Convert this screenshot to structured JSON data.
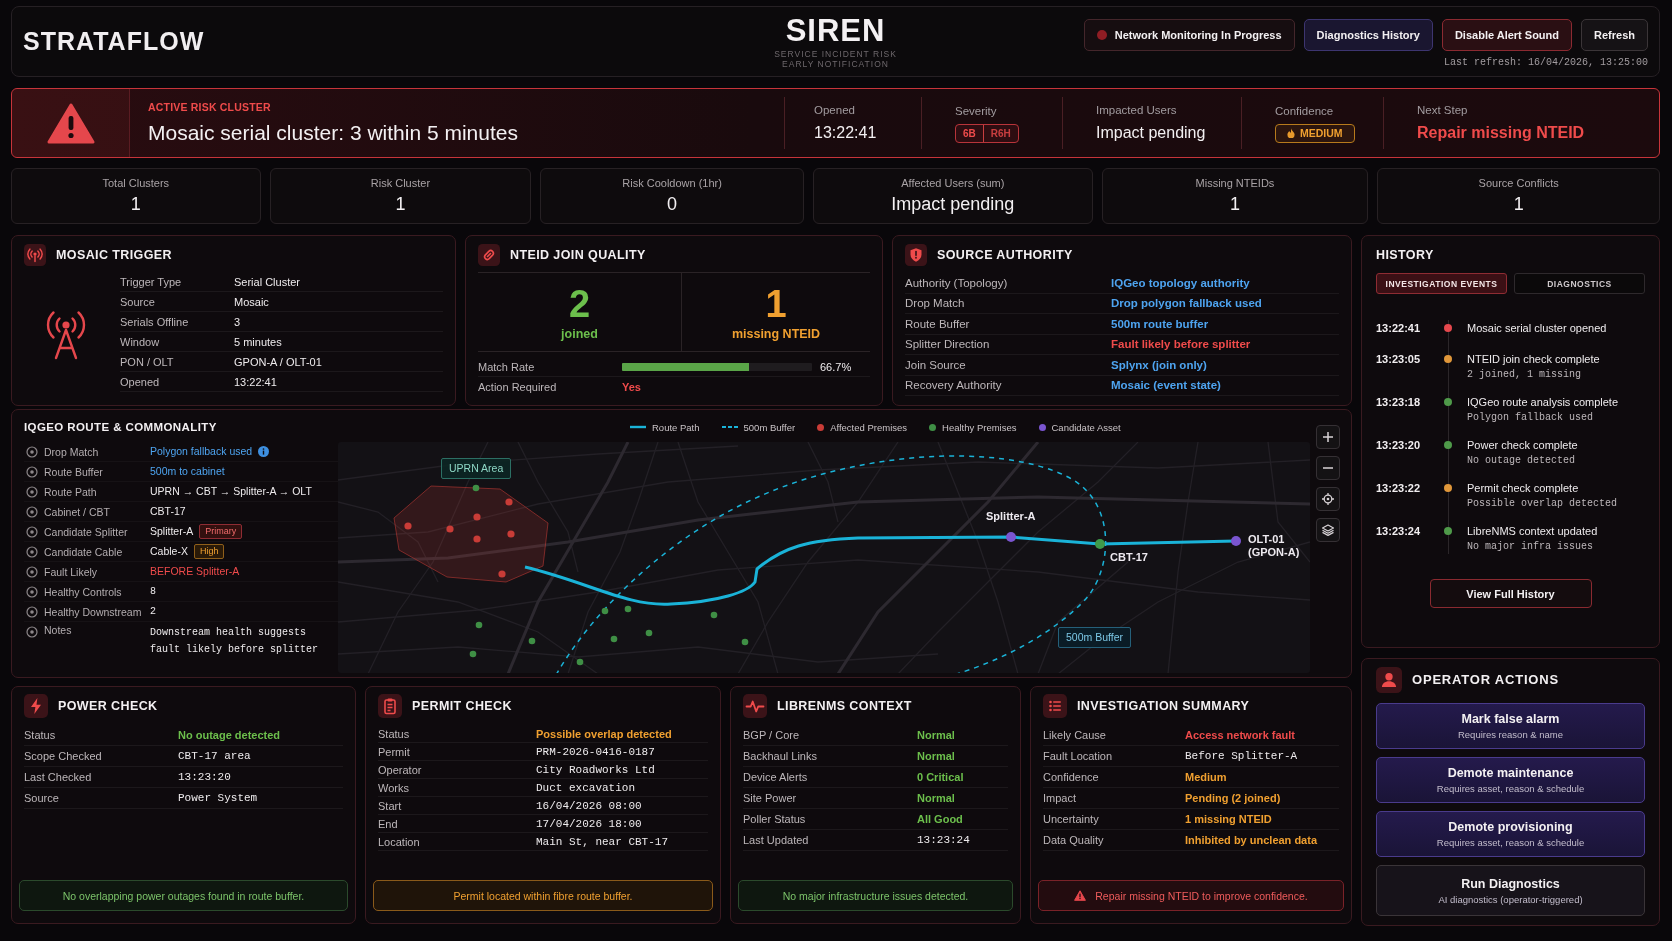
{
  "header": {
    "brand": "STRATAFLOW",
    "title": "SIREN",
    "subtitle": "SERVICE INCIDENT RISK EARLY NOTIFICATION",
    "buttons": [
      {
        "label": "Network Monitoring In Progress",
        "kind": "status"
      },
      {
        "label": "Diagnostics History",
        "kind": "accent"
      },
      {
        "label": "Disable Alert Sound",
        "kind": "danger"
      },
      {
        "label": "Refresh",
        "kind": "neutral"
      }
    ],
    "last_refresh": "Last refresh: 16/04/2026, 13:25:00"
  },
  "alert": {
    "eyebrow": "ACTIVE RISK CLUSTER",
    "title": "Mosaic serial cluster: 3 within 5 minutes",
    "fields": [
      {
        "label": "Opened",
        "kind": "text",
        "value": "13:22:41"
      },
      {
        "label": "Severity",
        "kind": "split",
        "parts": [
          "6B",
          "R6H"
        ]
      },
      {
        "label": "Impacted Users",
        "kind": "text",
        "value": "Impact pending"
      },
      {
        "label": "Confidence",
        "kind": "badge",
        "value": "MEDIUM"
      },
      {
        "label": "Next Step",
        "kind": "alert",
        "value": "Repair missing NTEID"
      }
    ]
  },
  "stats": [
    {
      "label": "Total Clusters",
      "value": "1"
    },
    {
      "label": "Risk Cluster",
      "value": "1"
    },
    {
      "label": "Risk Cooldown (1hr)",
      "value": "0"
    },
    {
      "label": "Affected Users (sum)",
      "value": "Impact pending"
    },
    {
      "label": "Missing NTEIDs",
      "value": "1"
    },
    {
      "label": "Source Conflicts",
      "value": "1"
    }
  ],
  "mosaic_trigger": {
    "title": "MOSAIC TRIGGER",
    "rows": [
      {
        "label": "Trigger Type",
        "value": "Serial Cluster",
        "kind": "plain"
      },
      {
        "label": "Source",
        "value": "Mosaic",
        "kind": "plain"
      },
      {
        "label": "Serials Offline",
        "value": "3",
        "kind": "plain"
      },
      {
        "label": "Window",
        "value": "5 minutes",
        "kind": "plain"
      },
      {
        "label": "PON / OLT",
        "value": "GPON-A / OLT-01",
        "kind": "plain"
      },
      {
        "label": "Opened",
        "value": "13:22:41",
        "kind": "plain"
      }
    ]
  },
  "nteid_join_quality": {
    "title": "NTEID JOIN QUALITY",
    "counts": [
      {
        "value": "2",
        "label": "joined",
        "kind": "success"
      },
      {
        "value": "1",
        "label": "missing NTEID",
        "kind": "warning"
      }
    ],
    "match_rate": {
      "label": "Match Rate",
      "level": 0.667,
      "reading": "66.7%"
    },
    "action_required": {
      "label": "Action Required",
      "value": "Yes",
      "kind": "danger"
    }
  },
  "source_authority": {
    "title": "SOURCE AUTHORITY",
    "rows": [
      {
        "label": "Authority (Topology)",
        "value": "IQGeo topology authority",
        "kind": "info"
      },
      {
        "label": "Drop Match",
        "value": "Drop polygon fallback used",
        "kind": "info"
      },
      {
        "label": "Route Buffer",
        "value": "500m route buffer",
        "kind": "info"
      },
      {
        "label": "Splitter Direction",
        "value": "Fault likely before splitter",
        "kind": "danger"
      },
      {
        "label": "Join Source",
        "value": "Splynx (join only)",
        "kind": "info"
      },
      {
        "label": "Recovery Authority",
        "value": "Mosaic (event state)",
        "kind": "info"
      }
    ]
  },
  "route": {
    "title": "IQGEO ROUTE & COMMONALITY",
    "rows": [
      {
        "label": "Drop Match",
        "value": "Polygon fallback used",
        "kind": "info",
        "info": true
      },
      {
        "label": "Route Buffer",
        "value": "500m to cabinet",
        "kind": "info",
        "info": false
      },
      {
        "label": "Route Path",
        "value": "UPRN → CBT → Splitter-A → OLT",
        "kind": "plain",
        "info": false
      },
      {
        "label": "Cabinet / CBT",
        "value": "CBT-17",
        "kind": "plain",
        "info": false
      },
      {
        "label": "Candidate Splitter",
        "value": "Splitter-A",
        "kind": "plain",
        "info": false,
        "badge": {
          "label": "Primary",
          "kind": "danger"
        }
      },
      {
        "label": "Candidate Cable",
        "value": "Cable-X",
        "kind": "plain",
        "info": false,
        "badge": {
          "label": "High",
          "kind": "warning"
        }
      },
      {
        "label": "Fault Likely",
        "value": "BEFORE Splitter-A",
        "kind": "danger",
        "info": false
      },
      {
        "label": "Healthy Controls",
        "value": "8",
        "kind": "mono",
        "info": false
      },
      {
        "label": "Healthy Downstream",
        "value": "2",
        "kind": "mono",
        "info": false
      },
      {
        "label": "Notes",
        "value": "Downstream health suggests fault likely before splitter",
        "kind": "mono",
        "info": false
      }
    ],
    "legend": [
      {
        "label": "Route Path",
        "kind": "line",
        "color": "#1ab3d8"
      },
      {
        "label": "500m Buffer",
        "kind": "dashed",
        "color": "#1ab3d8"
      },
      {
        "label": "Affected Premises",
        "kind": "dot",
        "color": "#c93c37"
      },
      {
        "label": "Healthy Premises",
        "kind": "dot",
        "color": "#3f8f45"
      },
      {
        "label": "Candidate Asset",
        "kind": "dot",
        "color": "#7a55d0"
      }
    ],
    "area_label": "UPRN Area",
    "buffer_label": "500m Buffer",
    "nodes": [
      {
        "label": "Splitter-A",
        "color": "#7a55d0"
      },
      {
        "label": "CBT-17",
        "color": "#3f9a4a"
      },
      {
        "label": "OLT-01 (GPON-A)",
        "color": "#7a55d0"
      }
    ]
  },
  "power_check": {
    "title": "POWER CHECK",
    "rows": [
      {
        "label": "Status",
        "value": "No outage detected",
        "kind": "success"
      },
      {
        "label": "Scope Checked",
        "value": "CBT-17 area",
        "kind": "mono"
      },
      {
        "label": "Last Checked",
        "value": "13:23:20",
        "kind": "mono"
      },
      {
        "label": "Source",
        "value": "Power System",
        "kind": "mono"
      }
    ],
    "note": {
      "text": "No overlapping power outages found in route buffer.",
      "kind": "success"
    }
  },
  "permit_check": {
    "title": "PERMIT CHECK",
    "rows": [
      {
        "label": "Status",
        "value": "Possible overlap detected",
        "kind": "warning"
      },
      {
        "label": "Permit",
        "value": "PRM-2026-0416-0187",
        "kind": "mono"
      },
      {
        "label": "Operator",
        "value": "City Roadworks Ltd",
        "kind": "mono"
      },
      {
        "label": "Works",
        "value": "Duct excavation",
        "kind": "mono"
      },
      {
        "label": "Start",
        "value": "16/04/2026 08:00",
        "kind": "mono"
      },
      {
        "label": "End",
        "value": "17/04/2026 18:00",
        "kind": "mono"
      },
      {
        "label": "Location",
        "value": "Main St, near CBT-17",
        "kind": "mono"
      }
    ],
    "note": {
      "text": "Permit located within fibre route buffer.",
      "kind": "warning"
    }
  },
  "librenms_context": {
    "title": "LIBRENMS CONTEXT",
    "rows": [
      {
        "label": "BGP / Core",
        "value": "Normal",
        "kind": "success"
      },
      {
        "label": "Backhaul Links",
        "value": "Normal",
        "kind": "success"
      },
      {
        "label": "Device Alerts",
        "value": "0 Critical",
        "kind": "success"
      },
      {
        "label": "Site Power",
        "value": "Normal",
        "kind": "success"
      },
      {
        "label": "Poller Status",
        "value": "All Good",
        "kind": "success"
      },
      {
        "label": "Last Updated",
        "value": "13:23:24",
        "kind": "mono"
      }
    ],
    "note": {
      "text": "No major infrastructure issues detected.",
      "kind": "success"
    }
  },
  "investigation_summary": {
    "title": "INVESTIGATION SUMMARY",
    "rows": [
      {
        "label": "Likely Cause",
        "value": "Access network fault",
        "kind": "danger"
      },
      {
        "label": "Fault Location",
        "value": "Before Splitter-A",
        "kind": "mono"
      },
      {
        "label": "Confidence",
        "value": "Medium",
        "kind": "warning"
      },
      {
        "label": "Impact",
        "value": "Pending (2 joined)",
        "kind": "warning"
      },
      {
        "label": "Uncertainty",
        "value": "1 missing NTEID",
        "kind": "warning"
      },
      {
        "label": "Data Quality",
        "value": "Inhibited by unclean data",
        "kind": "warning"
      }
    ],
    "note": {
      "text": "Repair missing NTEID to improve confidence.",
      "kind": "danger"
    }
  },
  "history": {
    "title": "HISTORY",
    "tabs": [
      {
        "label": "INVESTIGATION EVENTS",
        "selected": true
      },
      {
        "label": "DIAGNOSTICS",
        "selected": false
      }
    ],
    "events": [
      {
        "time": "13:22:41",
        "title": "Mosaic serial cluster opened",
        "color": "#e5484d"
      },
      {
        "time": "13:23:05",
        "title": "NTEID join check complete",
        "detail": "2 joined, 1 missing",
        "color": "#e0973a"
      },
      {
        "time": "13:23:18",
        "title": "IQGeo route analysis complete",
        "detail": "Polygon fallback used",
        "color": "#4f9a4a"
      },
      {
        "time": "13:23:20",
        "title": "Power check complete",
        "detail": "No outage detected",
        "color": "#4f9a4a"
      },
      {
        "time": "13:23:22",
        "title": "Permit check complete",
        "detail": "Possible overlap detected",
        "color": "#e0973a"
      },
      {
        "time": "13:23:24",
        "title": "LibreNMS context updated",
        "detail": "No major infra issues",
        "color": "#4f9a4a"
      }
    ],
    "view_all": "View Full History"
  },
  "operator_actions": {
    "title": "OPERATOR ACTIONS",
    "actions": [
      {
        "title": "Mark false alarm",
        "detail": "Requires reason & name",
        "kind": "workflow"
      },
      {
        "title": "Demote maintenance",
        "detail": "Requires asset, reason & schedule",
        "kind": "workflow"
      },
      {
        "title": "Demote provisioning",
        "detail": "Requires asset, reason & schedule",
        "kind": "workflow"
      },
      {
        "title": "Run Diagnostics",
        "detail": "AI diagnostics (operator-triggered)",
        "kind": "diagnostic"
      }
    ]
  }
}
